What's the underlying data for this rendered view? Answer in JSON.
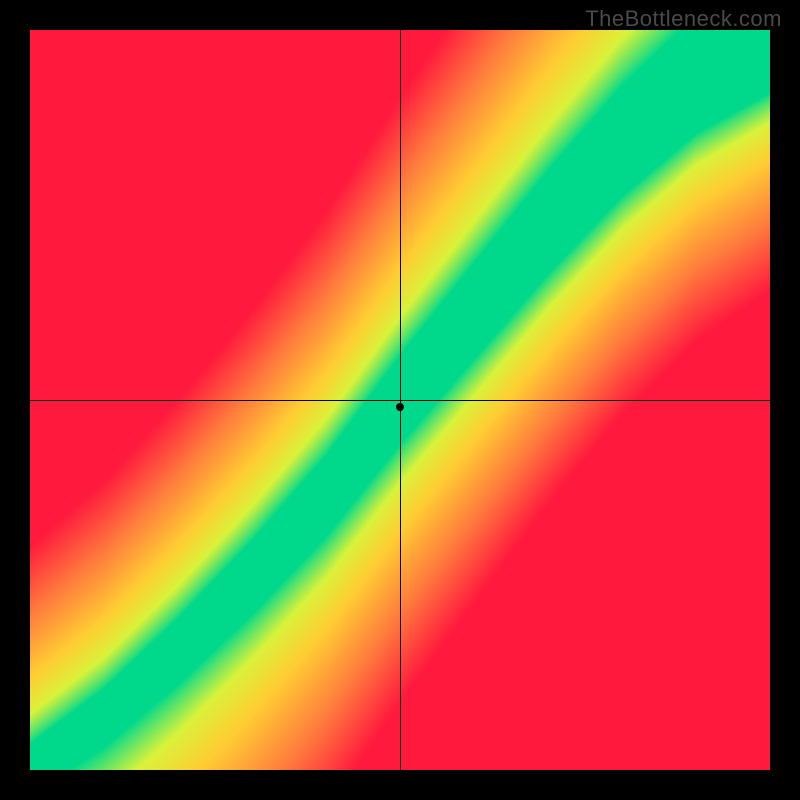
{
  "watermark": "TheBottleneck.com",
  "chart_data": {
    "type": "heatmap",
    "title": "",
    "xlabel": "",
    "ylabel": "",
    "description": "Bottleneck compatibility heatmap. X axis = CPU performance score (0–100). Y axis = GPU performance score (0–100). Color encodes balance: green = no bottleneck, yellow = mild bottleneck, red = severe bottleneck. The green band follows a slightly super-linear curve (GPU needs to outpace CPU at higher scores).",
    "xrange": [
      0,
      100
    ],
    "yrange": [
      0,
      100
    ],
    "grid": false,
    "crosshair": {
      "x": 50,
      "y": 50
    },
    "marker": {
      "x": 50,
      "y": 49
    },
    "balance_curve": {
      "note": "Ideal GPU score given CPU score (approximate, read from green ridge).",
      "x": [
        0,
        10,
        20,
        30,
        40,
        50,
        60,
        70,
        80,
        90,
        100
      ],
      "y": [
        0,
        7,
        16,
        26,
        37,
        50,
        62,
        74,
        85,
        94,
        100
      ]
    },
    "color_scale": [
      {
        "value": 0.0,
        "color": "#00d98b",
        "meaning": "balanced / no bottleneck"
      },
      {
        "value": 0.2,
        "color": "#d9f23a",
        "meaning": "slight mismatch"
      },
      {
        "value": 0.4,
        "color": "#ffcc33",
        "meaning": "moderate mismatch"
      },
      {
        "value": 0.7,
        "color": "#ff7a3d",
        "meaning": "large mismatch"
      },
      {
        "value": 1.0,
        "color": "#ff1a3d",
        "meaning": "severe bottleneck"
      }
    ],
    "resolution": 160
  }
}
